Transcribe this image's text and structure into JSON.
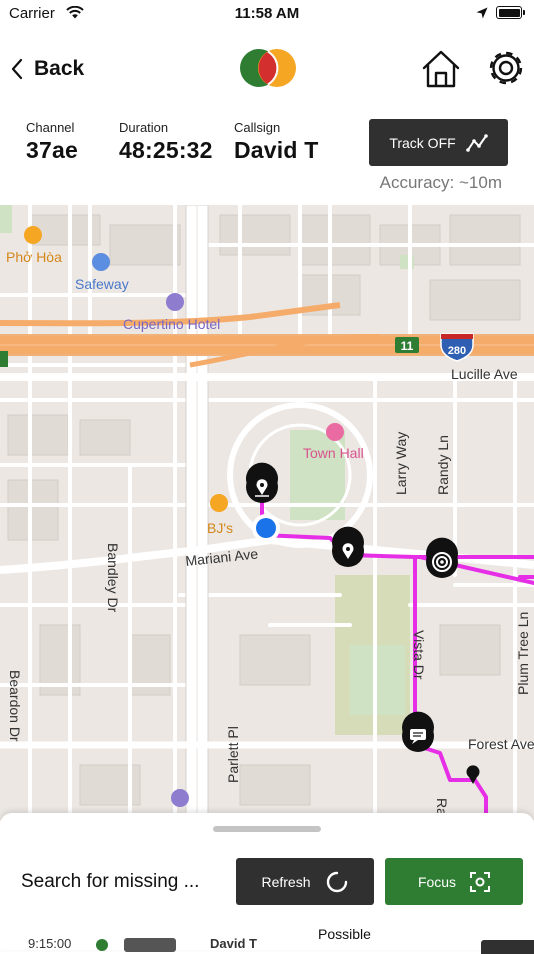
{
  "status_bar": {
    "carrier": "Carrier",
    "time": "11:58 AM"
  },
  "nav": {
    "back_label": "Back",
    "logo_colors": {
      "left": "#2e7d32",
      "middle": "#d32f2f",
      "right": "#f5a623"
    }
  },
  "info": {
    "channel": {
      "label": "Channel",
      "value": "37ae"
    },
    "duration": {
      "label": "Duration",
      "value": "48:25:32"
    },
    "callsign": {
      "label": "Callsign",
      "value": "David T"
    },
    "track_button": "Track OFF",
    "accuracy": "Accuracy: ~10m"
  },
  "map": {
    "pois": {
      "pho_hoa": "Phở Hòa",
      "safeway": "Safeway",
      "cupertino_hotel": "Cupertino Hotel",
      "town_hall": "Town Hall",
      "bjs": "BJ's"
    },
    "streets": {
      "lucille": "Lucille Ave",
      "larry": "Larry Way",
      "randy": "Randy Ln",
      "mariani": "Mariani Ave",
      "bandley": "Bandley Dr",
      "beardon": "Beardon Dr",
      "parlett": "Parlett Pl",
      "vista": "Vista Dr",
      "plum_tree": "Plum Tree Ln",
      "forest": "Forest Ave",
      "rai": "Rai"
    },
    "shields": {
      "route_11": "11",
      "interstate_280": "280"
    },
    "colors": {
      "track": "#e62ee6",
      "user_location": "#1a73e8",
      "freeway": "#f5ac6a",
      "land": "#ece7e3",
      "park": "#cfe3c4"
    }
  },
  "sheet": {
    "search_text": "Search for missing ...",
    "refresh_label": "Refresh",
    "focus_label": "Focus",
    "focus_color": "#2e7d32"
  },
  "peek_row": {
    "time": "9:15:00",
    "name": "David T",
    "possible": "Possible"
  }
}
